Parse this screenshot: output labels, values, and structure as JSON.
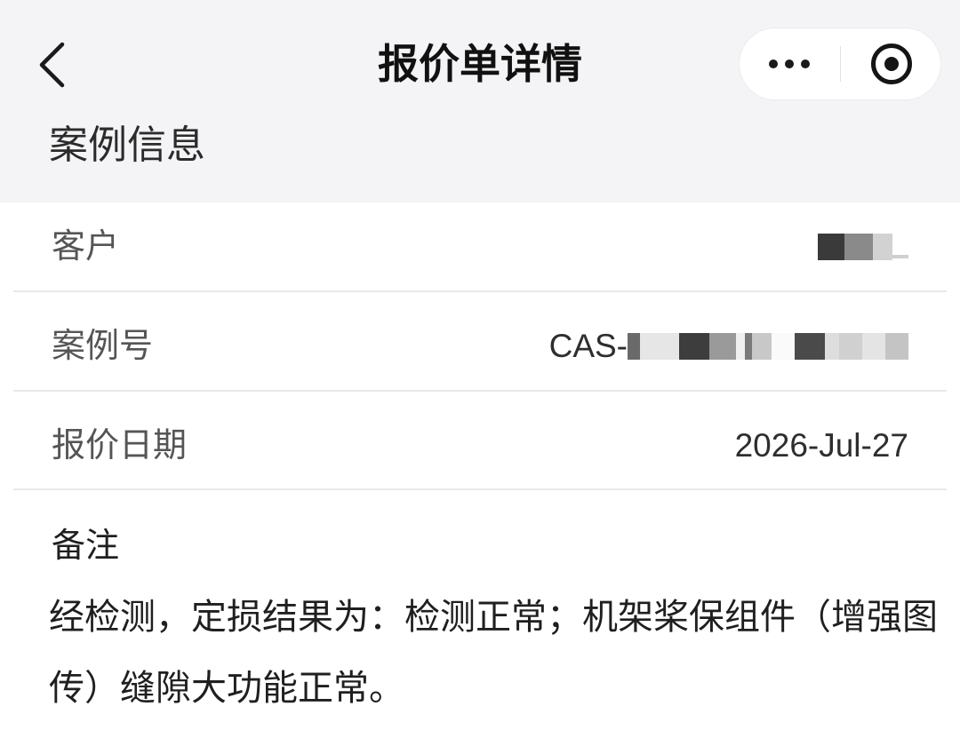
{
  "header": {
    "title": "报价单详情",
    "back_icon": "chevron-left-icon",
    "menu_icon": "more-dots-icon",
    "capsule_icon": "target-circle-icon"
  },
  "case_info": {
    "section_title": "案例信息",
    "rows": [
      {
        "label": "客户",
        "value_redacted": true
      },
      {
        "label": "案例号",
        "value": "CAS-",
        "value_redacted": true
      },
      {
        "label": "报价日期",
        "value": "2026-Jul-27"
      }
    ]
  },
  "remarks": {
    "title": "备注",
    "text": "经检测，定损结果为：检测正常；机架桨保组件（增强图传）缝隙大功能正常。"
  },
  "colors": {
    "header_background": "#f4f4f6",
    "card_background": "#ffffff",
    "text_primary": "#1f1f1f",
    "text_secondary": "#555555",
    "divider": "#e8e8e8"
  }
}
